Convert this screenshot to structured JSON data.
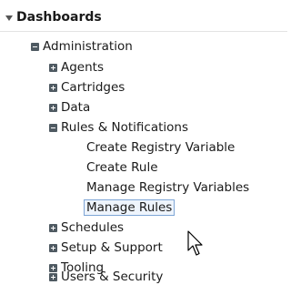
{
  "header": {
    "title": "Dashboards"
  },
  "tree": {
    "administration": {
      "label": "Administration",
      "children": {
        "agents": "Agents",
        "cartridges": "Cartridges",
        "data": "Data",
        "rules_notifications": {
          "label": "Rules & Notifications",
          "items": [
            "Create Registry Variable",
            "Create Rule",
            "Manage Registry Variables",
            "Manage Rules"
          ],
          "selected_item": "Manage Rules"
        },
        "schedules": "Schedules",
        "setup_support": "Setup & Support",
        "tooling": "Tooling",
        "users_security": "Users & Security"
      }
    }
  },
  "icons": {
    "header_toggle": "triangle-down-icon",
    "expanded": "minus-box-icon",
    "collapsed": "plus-box-icon",
    "cursor": "mouse-pointer-icon"
  },
  "colors": {
    "toggle_box": "#4f5a62",
    "selection_border": "#7fa6d6",
    "selection_fill": "#eef4fc"
  }
}
